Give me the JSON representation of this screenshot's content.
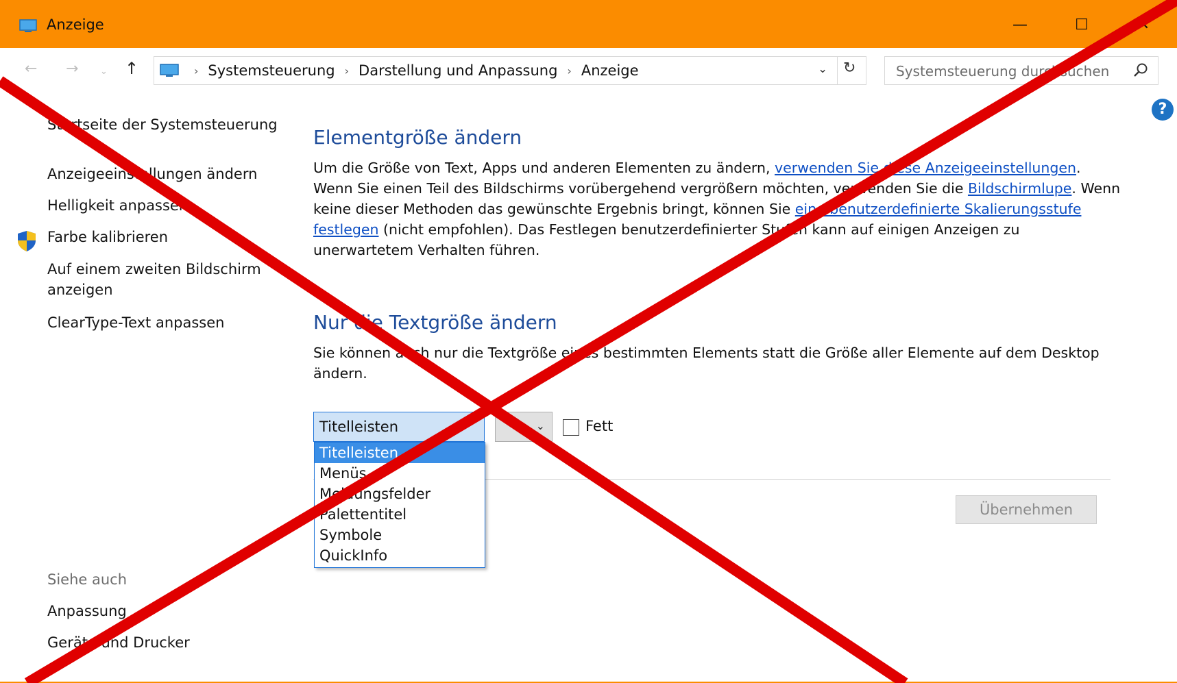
{
  "window": {
    "title": "Anzeige",
    "icon": "display-icon",
    "accent_color": "#fb8c00",
    "controls": {
      "minimize": "—",
      "maximize": "☐",
      "close": "✕"
    }
  },
  "navigation": {
    "back_glyph": "←",
    "forward_glyph": "→",
    "recent_glyph": "⌄",
    "up_glyph": "↑"
  },
  "address_bar": {
    "breadcrumbs": [
      "Systemsteuerung",
      "Darstellung und Anpassung",
      "Anzeige"
    ],
    "separator": "›",
    "dropdown_glyph": "⌄",
    "refresh_glyph": "↻"
  },
  "search": {
    "placeholder": "Systemsteuerung durchsuchen"
  },
  "help": {
    "glyph": "?"
  },
  "sidebar": {
    "items": [
      {
        "label": "Startseite der Systemsteuerung"
      },
      {
        "label": "Anzeigeeinstellungen ändern"
      },
      {
        "label": "Helligkeit anpassen"
      },
      {
        "label": "Farbe kalibrieren",
        "icon": "uac-shield-icon"
      },
      {
        "label": "Auf einem zweiten Bildschirm anzeigen"
      },
      {
        "label": "ClearType-Text anpassen"
      }
    ],
    "see_also": {
      "heading": "Siehe auch",
      "items": [
        {
          "label": "Anpassung"
        },
        {
          "label": "Geräte und Drucker"
        }
      ]
    }
  },
  "main": {
    "section1": {
      "heading": "Elementgröße ändern",
      "text_1": "Um die Größe von Text, Apps und anderen Elementen zu ändern, ",
      "link_1": "verwenden Sie diese Anzeigeeinstellungen",
      "text_2": ". Wenn Sie einen Teil des Bildschirms vorübergehend vergrößern möchten, verwenden Sie die ",
      "link_2": "Bildschirmlupe",
      "text_3": ". Wenn keine dieser Methoden das gewünschte Ergebnis bringt, können Sie ",
      "link_3": "eine benutzerdefinierte Skalierungsstufe festlegen",
      "text_4": " (nicht empfohlen). Das Festlegen benutzerdefinierter Stufen kann auf einigen Anzeigen zu unerwartetem Verhalten führen."
    },
    "section2": {
      "heading": "Nur die Textgröße ändern",
      "text": "Sie können auch nur die Textgröße eines bestimmten Elements statt die Größe aller Elemente auf dem Desktop ändern."
    },
    "element_select": {
      "value": "Titelleisten",
      "options": [
        "Titelleisten",
        "Menüs",
        "Meldungsfelder",
        "Palettentitel",
        "Symbole",
        "QuickInfo"
      ],
      "selected_index": 0
    },
    "size_select": {
      "arrow_glyph": "⌄"
    },
    "bold_checkbox": {
      "label": "Fett",
      "checked": false
    },
    "apply_button": {
      "label": "Übernehmen",
      "enabled": false
    }
  },
  "overlay": {
    "type": "red-cross",
    "color": "#e00000"
  }
}
